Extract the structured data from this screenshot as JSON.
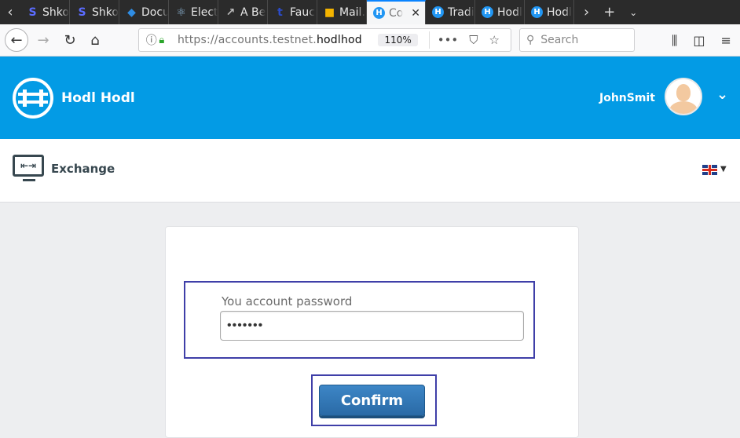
{
  "browser": {
    "tabs": [
      {
        "label": "Shko",
        "favicon": "S",
        "favcolor": "#5b6cff"
      },
      {
        "label": "Shko",
        "favicon": "S",
        "favcolor": "#5b6cff"
      },
      {
        "label": "Docu",
        "favicon": "◆",
        "favcolor": "#2f8de4"
      },
      {
        "label": "Elect",
        "favicon": "⚛",
        "favcolor": "#8fb8d8"
      },
      {
        "label": "A Be",
        "favicon": "↗",
        "favcolor": "#bbbbbb"
      },
      {
        "label": "Fauc",
        "favicon": "t",
        "favcolor": "#2b4bc8"
      },
      {
        "label": "Mail.",
        "favicon": "■",
        "favcolor": "#f4b400"
      },
      {
        "label": "Co",
        "favicon": "H",
        "favcolor": "#2196f3",
        "active": true
      },
      {
        "label": "Tradi",
        "favicon": "H",
        "favcolor": "#2196f3"
      },
      {
        "label": "Hodl",
        "favicon": "H",
        "favcolor": "#2196f3"
      },
      {
        "label": "Hodl",
        "favicon": "H",
        "favcolor": "#2196f3"
      }
    ],
    "url_prefix": "https://accounts.testnet.",
    "url_domain": "hodlhod",
    "zoom": "110%",
    "search_placeholder": "Search"
  },
  "header": {
    "brand": "Hodl Hodl",
    "username": "JohnSmit",
    "color": "#039be5"
  },
  "subheader": {
    "section": "Exchange",
    "language_flag": "uk-flag-icon"
  },
  "form": {
    "password_label": "You account password",
    "password_value": "1234567",
    "confirm_label": "Confirm"
  }
}
